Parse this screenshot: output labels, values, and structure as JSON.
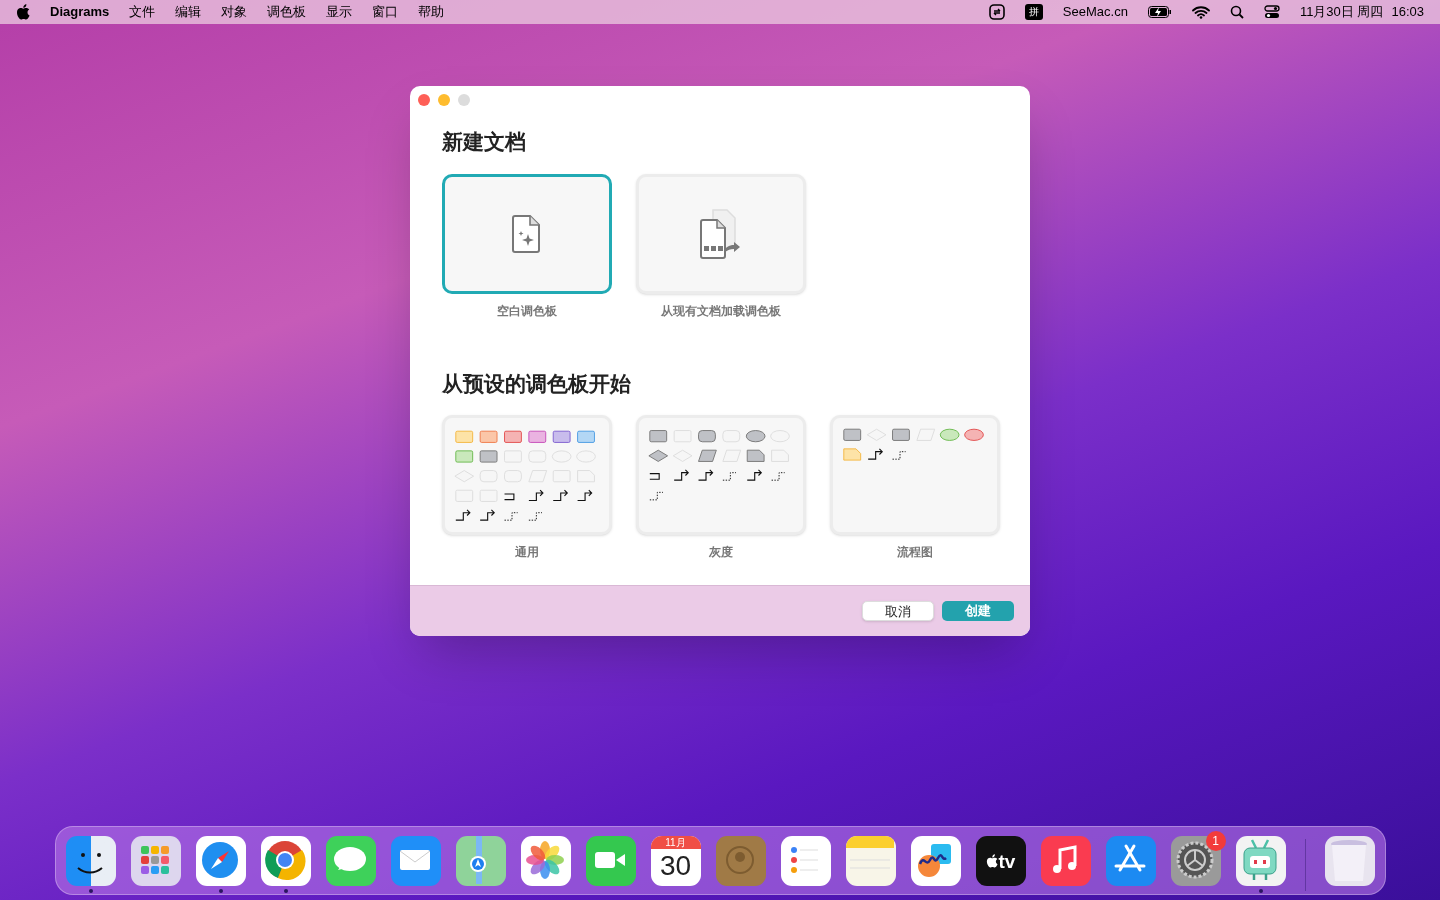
{
  "menubar": {
    "app_name": "Diagrams",
    "menus": [
      "文件",
      "编辑",
      "对象",
      "调色板",
      "显示",
      "窗口",
      "帮助"
    ],
    "input_method": "拼",
    "site": "SeeMac.cn",
    "date": "11月30日 周四",
    "time": "16:03"
  },
  "dialog": {
    "new_section_title": "新建文档",
    "new_options": [
      {
        "kind": "blank",
        "label": "空白调色板",
        "selected": true
      },
      {
        "kind": "load",
        "label": "从现有文档加载调色板",
        "selected": false
      }
    ],
    "preset_section_title": "从预设的调色板开始",
    "presets": [
      {
        "kind": "general",
        "label": "通用",
        "selected": false
      },
      {
        "kind": "gray",
        "label": "灰度",
        "selected": false
      },
      {
        "kind": "flowchart",
        "label": "流程图",
        "selected": false
      }
    ],
    "buttons": [
      {
        "kind": "cancel",
        "label": "取消"
      },
      {
        "kind": "create",
        "label": "创建"
      }
    ]
  },
  "dock": [
    {
      "kind": "finder",
      "running": true
    },
    {
      "kind": "launchpad",
      "running": false
    },
    {
      "kind": "safari",
      "running": true
    },
    {
      "kind": "chrome",
      "running": true
    },
    {
      "kind": "messages",
      "running": false
    },
    {
      "kind": "mail",
      "running": false
    },
    {
      "kind": "maps",
      "running": false
    },
    {
      "kind": "photos",
      "running": false
    },
    {
      "kind": "facetime",
      "running": false
    },
    {
      "kind": "calendar",
      "running": false,
      "month": "11月",
      "day": "30"
    },
    {
      "kind": "contacts",
      "running": false
    },
    {
      "kind": "reminders",
      "running": false
    },
    {
      "kind": "notes",
      "running": false
    },
    {
      "kind": "freeform",
      "running": false
    },
    {
      "kind": "tv",
      "running": false,
      "text": "tv"
    },
    {
      "kind": "music",
      "running": false
    },
    {
      "kind": "appstore",
      "running": false
    },
    {
      "kind": "settings",
      "running": false,
      "badge": "1"
    },
    {
      "kind": "diagrams",
      "running": true
    },
    {
      "kind": "trash",
      "running": false,
      "separator_before": true
    }
  ]
}
